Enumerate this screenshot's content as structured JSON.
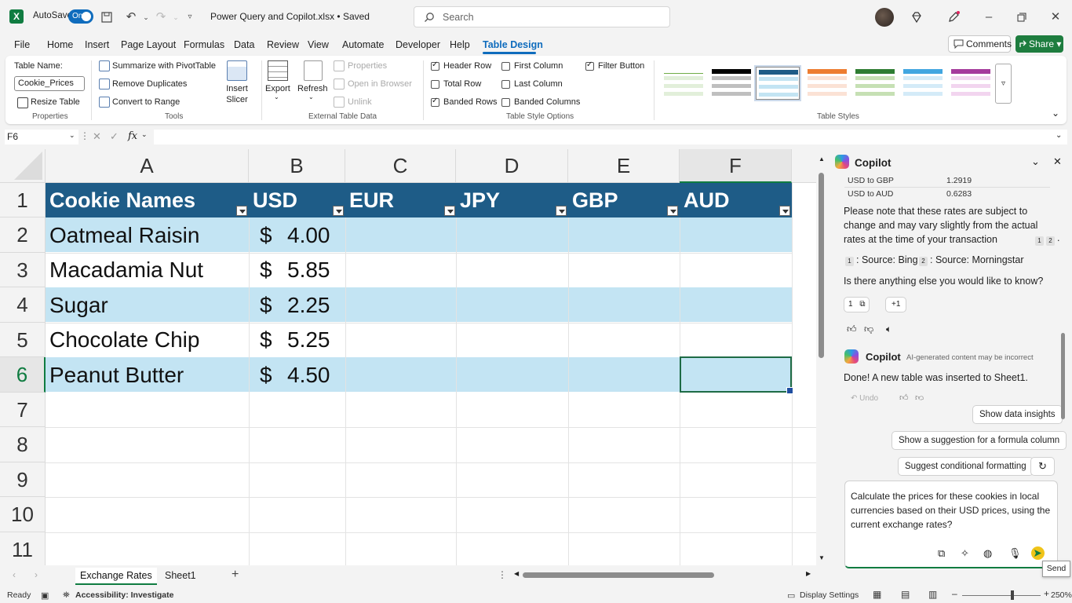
{
  "titlebar": {
    "app_icon": "excel-logo",
    "app_icon_letter": "X",
    "autosave_label": "AutoSave",
    "autosave_state": "On",
    "doc_title": "Power Query and Copilot.xlsx • Saved",
    "search_placeholder": "Search"
  },
  "menu": {
    "items": [
      "File",
      "Home",
      "Insert",
      "Page Layout",
      "Formulas",
      "Data",
      "Review",
      "View",
      "Automate",
      "Developer",
      "Help",
      "Table Design"
    ],
    "active": "Table Design",
    "comments": "Comments",
    "share": "Share"
  },
  "ribbon": {
    "properties": {
      "table_name_label": "Table Name:",
      "table_name_value": "Cookie_Prices",
      "resize": "Resize Table",
      "group": "Properties"
    },
    "tools": {
      "summarize": "Summarize with PivotTable",
      "remove_dup": "Remove Duplicates",
      "convert": "Convert to Range",
      "insert_slicer": "Insert Slicer",
      "group": "Tools"
    },
    "external": {
      "export": "Export",
      "refresh": "Refresh",
      "properties": "Properties",
      "open_browser": "Open in Browser",
      "unlink": "Unlink",
      "group": "External Table Data"
    },
    "style_options": {
      "header_row": "Header Row",
      "total_row": "Total Row",
      "banded_rows": "Banded Rows",
      "first_column": "First Column",
      "last_column": "Last Column",
      "banded_columns": "Banded Columns",
      "filter_button": "Filter Button",
      "group": "Table Style Options"
    },
    "table_styles_group": "Table Styles"
  },
  "formula_bar": {
    "name_box": "F6",
    "fx": "fx",
    "formula": ""
  },
  "columns": [
    "A",
    "B",
    "C",
    "D",
    "E",
    "F"
  ],
  "rows": [
    "1",
    "2",
    "3",
    "4",
    "5",
    "6",
    "7",
    "8",
    "9",
    "10",
    "11"
  ],
  "table": {
    "headers": [
      "Cookie Names",
      "USD",
      "EUR",
      "JPY",
      "GBP",
      "AUD"
    ],
    "rows": [
      {
        "name": "Oatmeal Raisin",
        "currency": "$",
        "usd": "4.00"
      },
      {
        "name": "Macadamia Nut",
        "currency": "$",
        "usd": "5.85"
      },
      {
        "name": "Sugar",
        "currency": "$",
        "usd": "2.25"
      },
      {
        "name": "Chocolate Chip",
        "currency": "$",
        "usd": "5.25"
      },
      {
        "name": "Peanut Butter",
        "currency": "$",
        "usd": "4.50"
      }
    ]
  },
  "sheets": {
    "tabs": [
      "Exchange Rates",
      "Sheet1"
    ],
    "active": "Exchange Rates"
  },
  "status": {
    "ready": "Ready",
    "accessibility": "Accessibility: Investigate",
    "display": "Display Settings",
    "zoom": "250%"
  },
  "copilot": {
    "title": "Copilot",
    "rates": [
      {
        "label": "USD to GBP",
        "value": "1.2919"
      },
      {
        "label": "USD to AUD",
        "value": "0.6283"
      }
    ],
    "note_line1": "Please note that these rates are subject to",
    "note_line2": "change and may vary slightly from the actual",
    "note_line3": "rates at the time of your transaction",
    "sources": [
      {
        "num": "1",
        "text": ": Source: Bing"
      },
      {
        "num": "2",
        "text": ": Source: Morningstar"
      }
    ],
    "question": "Is there anything else you would like to know?",
    "ref_one": "1",
    "ref_more": "+1",
    "reply_name": "Copilot",
    "reply_disclaimer": "AI-generated content may be incorrect",
    "reply_text": "Done! A new table was inserted to Sheet1.",
    "undo": "Undo",
    "suggestions": [
      "Show data insights",
      "Show a suggestion for a formula column",
      "Suggest conditional formatting"
    ],
    "input_text": "Calculate the prices for these cookies in local currencies based on their USD prices, using the current exchange rates?",
    "send_tooltip": "Send"
  },
  "colors": {
    "table_header": "#1e5c87",
    "band": "#c3e4f3",
    "excel_green": "#107c41",
    "accent": "#0f6cbd"
  }
}
